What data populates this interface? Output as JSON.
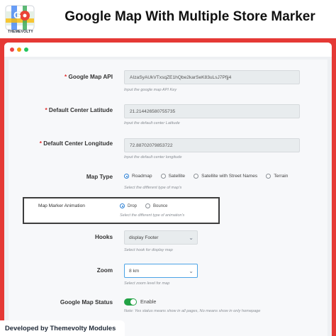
{
  "header": {
    "logo_text": "THEMEVOLTY",
    "title": "Google Map With Multiple Store Marker"
  },
  "form": {
    "api_key": {
      "label": "Google Map API",
      "value": "AIzaSyAUkVTxsqZE1hQbe2karSeK83uLsJ7Pfjj4",
      "help": "Input the google map API Key"
    },
    "center_lat": {
      "label": "Default Center Latitude",
      "value": "21.214426580755735",
      "help": "Input the default center Latitude"
    },
    "center_lng": {
      "label": "Default Center Longitude",
      "value": "72.88702079853722",
      "help": "Input the default center longitude"
    },
    "map_type": {
      "label": "Map Type",
      "options": [
        "Roadmap",
        "Satellite",
        "Satellite with Street Names",
        "Terrain"
      ],
      "selected": "Roadmap",
      "help": "Select the different type of map's"
    },
    "animation": {
      "label": "Map Marker Animation",
      "options": [
        "Drop",
        "Bounce"
      ],
      "selected": "Drop",
      "help": "Select the different type of animation's"
    },
    "hooks": {
      "label": "Hooks",
      "value": "display Footer",
      "help": "Select hook for display map"
    },
    "zoom": {
      "label": "Zoom",
      "value": "8 km",
      "help": "Select zoom level for map"
    },
    "status": {
      "label": "Google Map Status",
      "toggle_label": "Enable",
      "enabled": true,
      "help": "Note: Yes status means show in all pages, No means show in only homepage"
    }
  },
  "footer": {
    "text": "Developed by Themevolty Modules"
  },
  "colors": {
    "brand_red": "#e53935",
    "radio_active": "#2a7fd4",
    "toggle_on": "#22a245"
  }
}
